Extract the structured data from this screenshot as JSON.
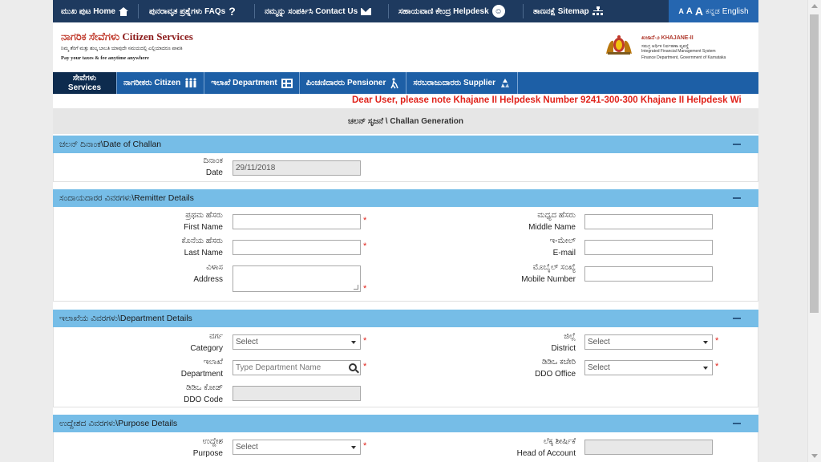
{
  "topbar": {
    "home": "ಮುಖ ಪುಟ Home",
    "faqs": "ಪುನರಾವೃತ ಪ್ರಶ್ನೆಗಳು FAQs",
    "contact": "ನಮ್ಮನ್ನು ಸಂಪರ್ಕಿಸಿ Contact Us",
    "helpdesk": "ಸಹಾಯವಾಣಿ ಕೇಂದ್ರ Helpdesk",
    "sitemap": "ತಾಣನಕ್ಷೆ Sitemap",
    "font_small": "A",
    "font_medium": "A",
    "font_large": "A",
    "lang_kannada": "ಕನ್ನಡ",
    "lang_english": "English"
  },
  "header": {
    "title_kn": "ನಾಗರಿಕ ಸೇವೆಗಳು ",
    "title_en": "Citizen Services",
    "subtitle_kn": "ನಿಮ್ಮ ತೆರಿಗೆ ಮತ್ತು ಶುಲ್ಕ ಬಾಬತಿ ಯಾವುದೇ ಸಮಯದಲ್ಲಿ ಎಲ್ಲಿಯಾದರೂ ಪಾವತಿ",
    "subtitle_en": "Pay your taxes & fee anytime anywhere",
    "khajane_title": "ಖಜಾನೆ-೨ KHAJANE-II",
    "khajane_sub1": "ಸಮಗ್ರ ಆರ್ಥಿಕ ನಿರ್ವಹಣಾ ವ್ಯವಸ್ಥೆ",
    "khajane_sub2": "Integrated Financial Management System",
    "khajane_sub3": "Finance Department, Government of Karnataka"
  },
  "nav": {
    "services_kn": "ಸೇವೆಗಳು",
    "services_en": "Services",
    "citizen": "ನಾಗರೀಕರು Citizen",
    "department": "ಇಲಾಖೆ Department",
    "pensioner": "ಪಿಂಚಣಿದಾರರು Pensioner",
    "supplier": "ಸರಬರಾಜುದಾರರು Supplier"
  },
  "marquee": "Dear User, please note Khajane II Helpdesk Number 9241-300-300 Khajane II Helpdesk Wi",
  "page_title": "ಚಲನ್ ಸೃಜನೆ \\ Challan Generation",
  "sections": {
    "date": {
      "title": "ಚಲನ್ ದಿನಾಂಕ\\Date of Challan",
      "date_label_kn": "ದಿನಾಂಕ",
      "date_label_en": "Date",
      "date_value": "29/11/2018"
    },
    "remitter": {
      "title": "ಸಂದಾಯದಾರರ ವಿವರಗಳು\\Remitter Details",
      "first_name_kn": "ಪ್ರಥಮ ಹೆಸರು",
      "first_name_en": "First Name",
      "middle_name_kn": "ಮಧ್ಯದ ಹೆಸರು",
      "middle_name_en": "Middle Name",
      "last_name_kn": "ಕೊನೆಯ ಹೆಸರು",
      "last_name_en": "Last Name",
      "email_kn": "ಇ-ಮೇಲ್",
      "email_en": "E-mail",
      "address_kn": "ವಿಳಾಸ",
      "address_en": "Address",
      "mobile_kn": "ಮೊಬೈಲ್ ಸಂಖ್ಯೆ",
      "mobile_en": "Mobile Number"
    },
    "department": {
      "title": "ಇಲಾಖೆಯ ವಿವರಗಳು\\Department Details",
      "category_kn": "ವರ್ಗ",
      "category_en": "Category",
      "category_value": "Select",
      "district_kn": "ಜಿಲ್ಲೆ",
      "district_en": "District",
      "district_value": "Select",
      "department_kn": "ಇಲಾಖೆ",
      "department_en": "Department",
      "department_placeholder": "Type Department Name",
      "ddo_office_kn": "ಡಿಡಿಒ ಕಚೇರಿ",
      "ddo_office_en": "DDO Office",
      "ddo_office_value": "Select",
      "ddo_code_kn": "ಡಿಡಿಒ ಕೋಡ್",
      "ddo_code_en": "DDO Code"
    },
    "purpose": {
      "title": "ಉದ್ದೇಶದ ವಿವರಗಳು\\Purpose Details",
      "purpose_kn": "ಉದ್ದೇಶ",
      "purpose_en": "Purpose",
      "purpose_value": "Select",
      "head_kn": "ಲೆಕ್ಕ ಶೀರ್ಷಿಕೆ",
      "head_en": "Head of Account"
    }
  },
  "required_mark": "*",
  "colors": {
    "topbar": "#1e3a5f",
    "nav": "#1d5fa6",
    "section_header": "#76bde7",
    "marquee": "#e0231b"
  }
}
